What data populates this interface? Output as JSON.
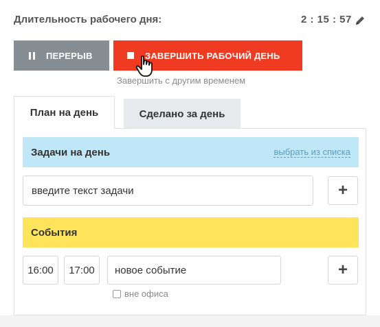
{
  "workday": {
    "duration_label": "Длительность рабочего дня:",
    "timer": "2 : 15 : 57",
    "edit_icon": "pencil-icon"
  },
  "actions": {
    "pause_label": "ПЕРЕРЫВ",
    "finish_label": "ЗАВЕРШИТЬ РАБОЧИЙ ДЕНЬ",
    "finish_other_time": "Завершить с другим временем",
    "pause_color": "#868d93",
    "finish_color": "#ee3b22"
  },
  "tabs": [
    {
      "label": "План на день",
      "active": true
    },
    {
      "label": "Сделано за день",
      "active": false
    }
  ],
  "tasks": {
    "title": "Задачи на день",
    "choose_link": "выбрать из списка",
    "input_value": "введите текст задачи",
    "add_label": "+",
    "color": "#bfe7f7"
  },
  "events": {
    "title": "События",
    "start_time": "16:00",
    "end_time": "17:00",
    "event_value": "новое событие",
    "add_label": "+",
    "offsite_label": "вне офиса",
    "offsite_checked": false,
    "color": "#fde45a"
  }
}
